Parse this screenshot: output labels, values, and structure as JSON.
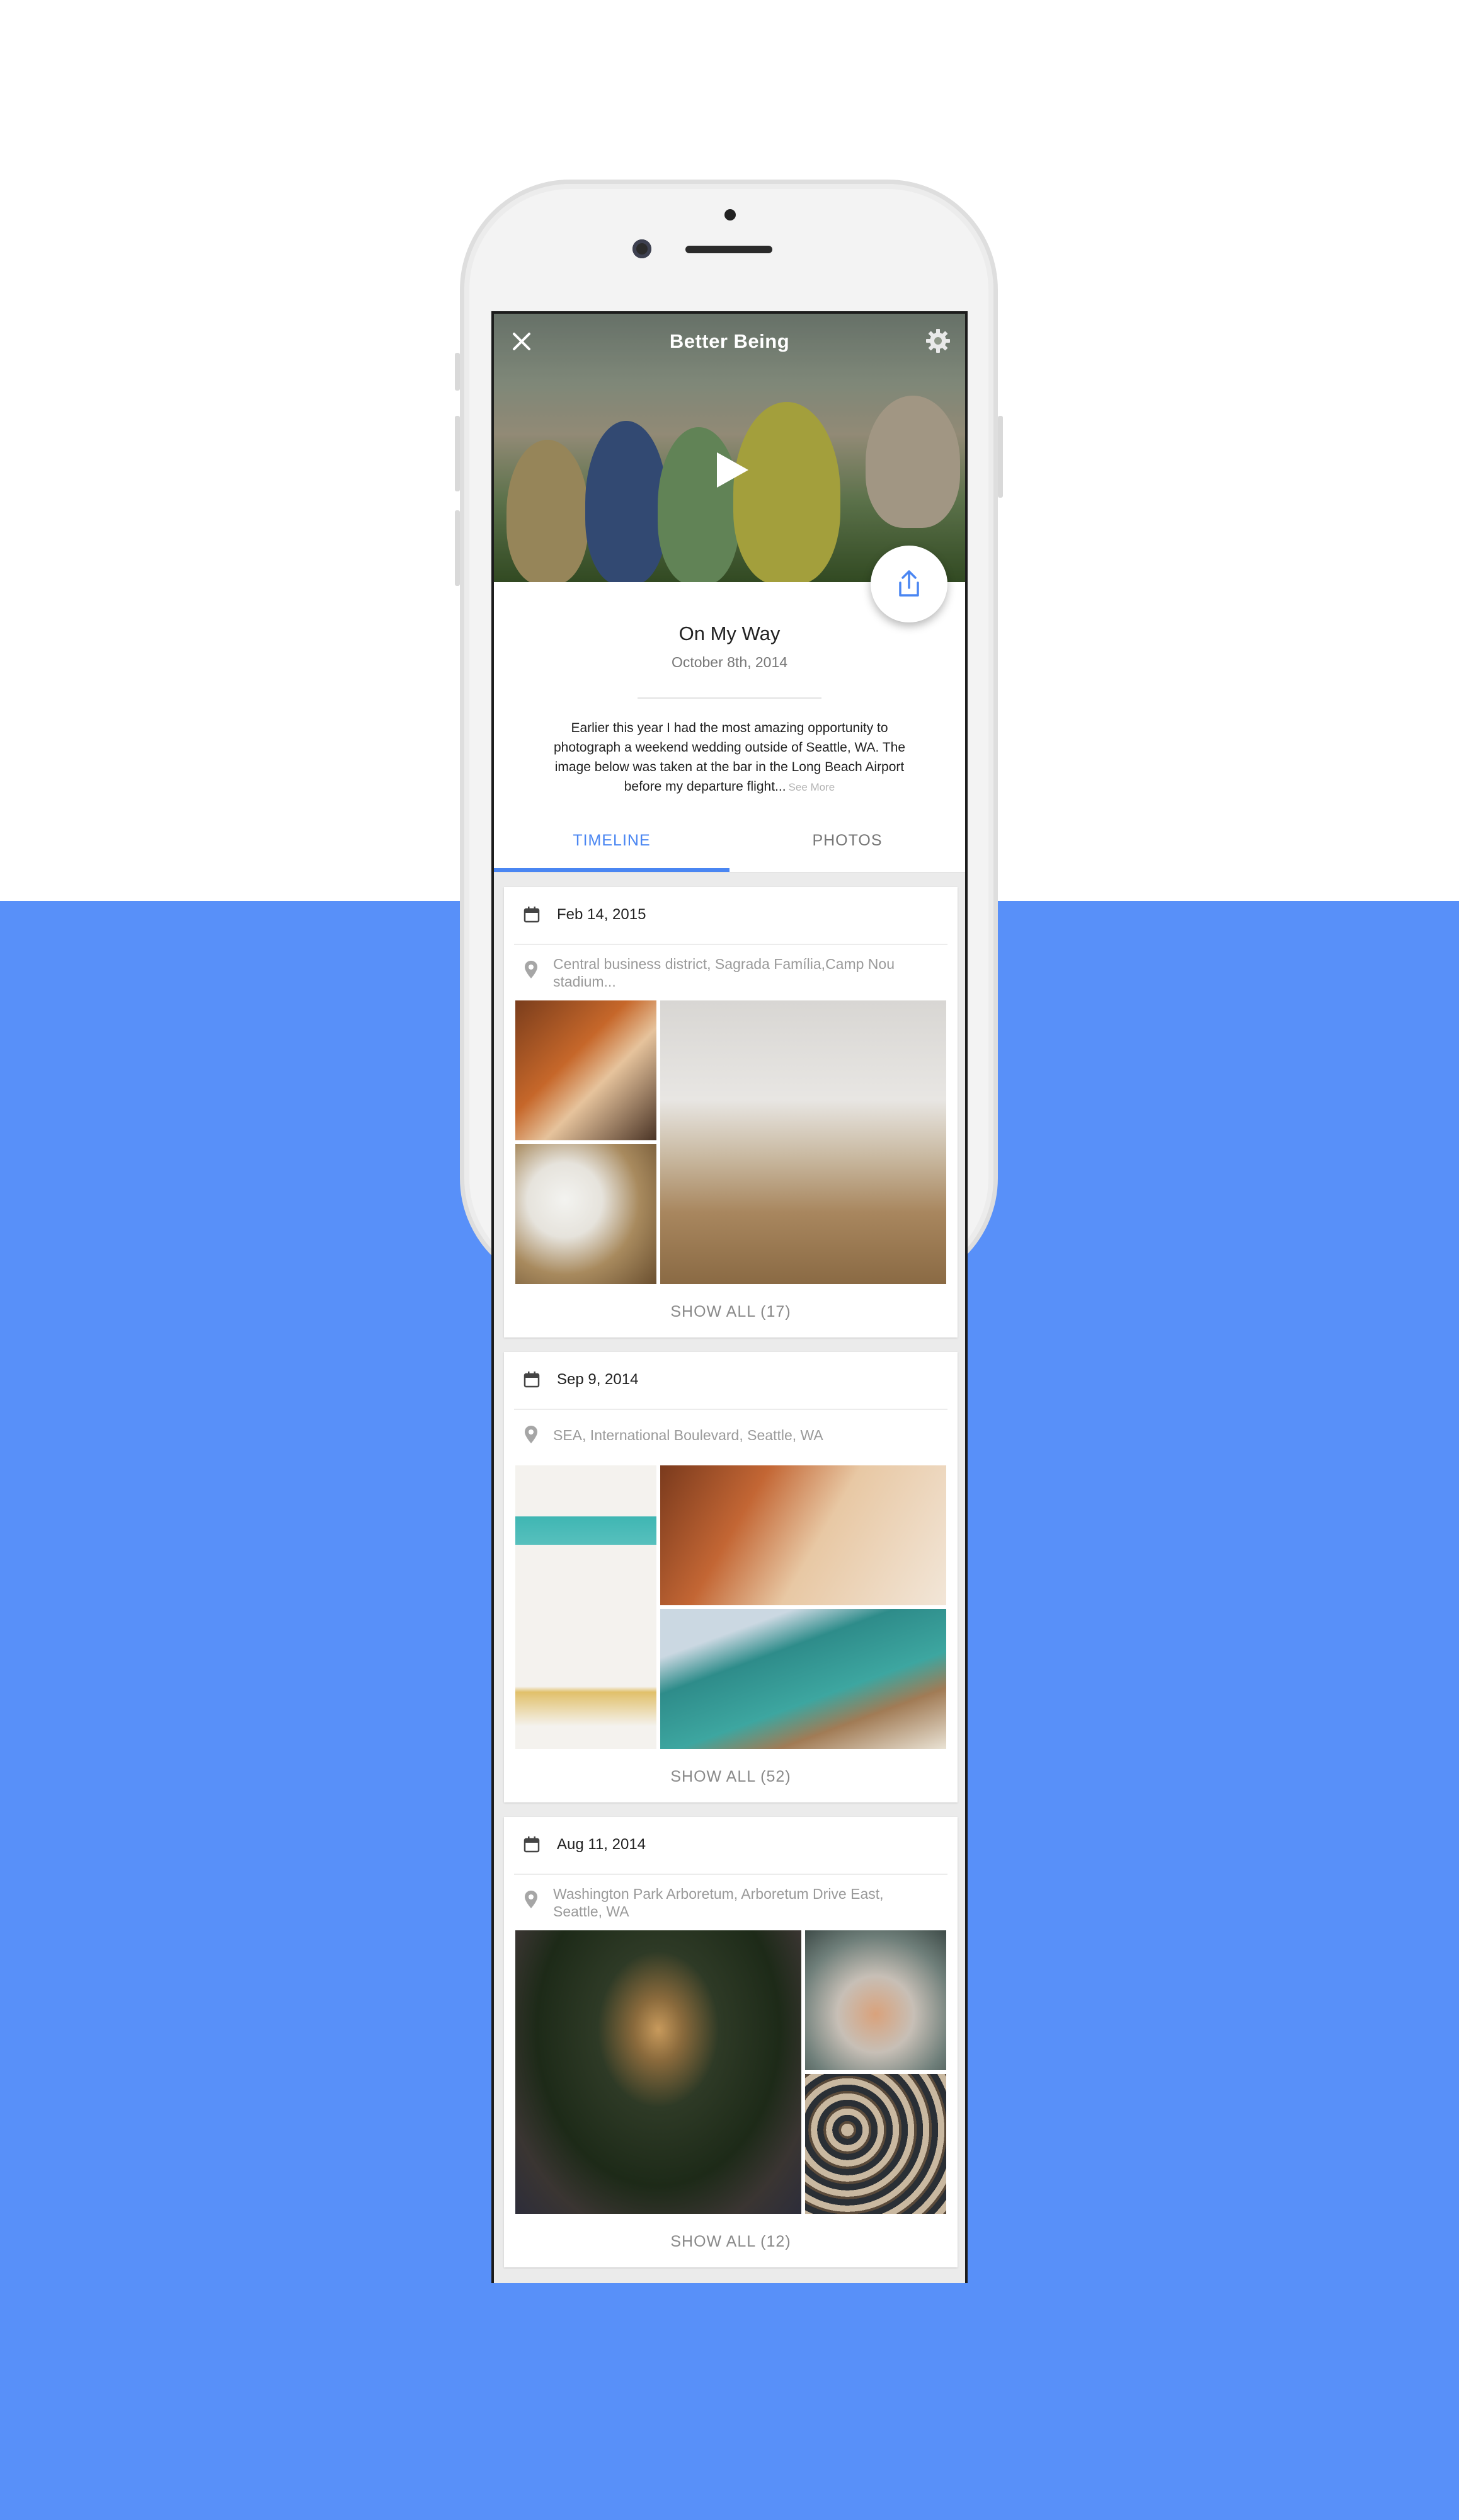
{
  "header": {
    "title": "Better Being",
    "close_icon": "close-icon",
    "settings_icon": "gear-icon",
    "play_icon": "play-icon",
    "share_icon": "share-icon"
  },
  "post": {
    "title": "On My Way",
    "date": "October 8th, 2014",
    "description": "Earlier this year I had the most amazing opportunity to photograph a weekend wedding outside of Seattle, WA. The image below was taken at the bar in the Long Beach Airport before my departure flight...",
    "see_more": "See More"
  },
  "tabs": [
    {
      "label": "TIMELINE",
      "active": true
    },
    {
      "label": "PHOTOS",
      "active": false
    }
  ],
  "timeline": [
    {
      "date": "Feb 14, 2015",
      "location": "Central business district, Sagrada Família,Camp Nou stadium...",
      "show_all": "SHOW ALL (17)"
    },
    {
      "date": "Sep 9, 2014",
      "location": "SEA, International Boulevard, Seattle, WA",
      "show_all": "SHOW ALL (52)"
    },
    {
      "date": "Aug 11, 2014",
      "location": "Washington Park Arboretum, Arboretum Drive East, Seattle, WA",
      "show_all": "SHOW ALL (12)"
    }
  ],
  "colors": {
    "accent": "#4a86f2",
    "background_blue": "#5890f9"
  }
}
